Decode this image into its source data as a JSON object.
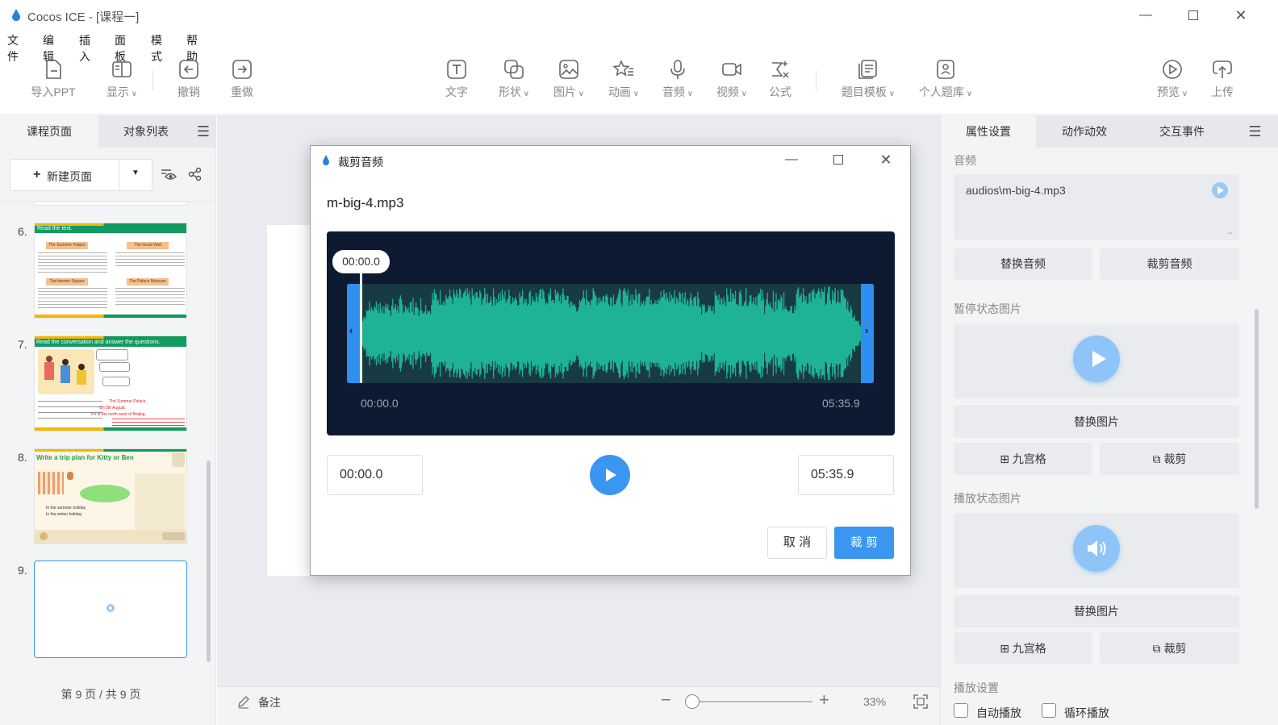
{
  "window": {
    "title": "Cocos ICE - [课程一]"
  },
  "menu": [
    "文件",
    "编辑",
    "插入",
    "面板",
    "模式",
    "帮助"
  ],
  "toolbar": {
    "import_ppt": "导入PPT",
    "display": "显示",
    "undo": "撤销",
    "redo": "重做",
    "text": "文字",
    "shape": "形状",
    "image": "图片",
    "animation": "动画",
    "audio": "音频",
    "video": "视频",
    "formula": "公式",
    "question_template": "题目模板",
    "personal_bank": "个人题库",
    "preview": "预览",
    "upload": "上传"
  },
  "left_panel": {
    "tabs": [
      "课程页面",
      "对象列表"
    ],
    "new_page": "新建页面",
    "pages": [
      {
        "num": "6.",
        "heading": "Read the text.",
        "labels": [
          "The Summer Palace",
          "The Great Wall",
          "Tian'anmen Square",
          "The Palace Museum"
        ]
      },
      {
        "num": "7.",
        "heading": "Read the conversation and answer the questions.",
        "red_answers": [
          "The Summer Palace.",
          "On 5th August.",
          "It's in the north-west of Beijing."
        ]
      },
      {
        "num": "8.",
        "heading": "Write a trip plan for Kitty or Ben",
        "labels": [
          "In the summer holiday",
          "In the winter holiday"
        ]
      },
      {
        "num": "9.",
        "heading": ""
      }
    ],
    "footer": "第 9 页 / 共 9 页"
  },
  "bottom_bar": {
    "notes": "备注",
    "zoom": "33%"
  },
  "right_panel": {
    "tabs": [
      "属性设置",
      "动作动效",
      "交互事件"
    ],
    "audio_label": "音频",
    "audio_path": "audios\\m-big-4.mp3",
    "replace_audio": "替换音频",
    "crop_audio": "裁剪音频",
    "pause_image_label": "暂停状态图片",
    "replace_image": "替换图片",
    "nine_grid": "九宫格",
    "crop": "裁剪",
    "play_image_label": "播放状态图片",
    "play_settings_label": "播放设置",
    "autoplay": "自动播放",
    "loop": "循环播放"
  },
  "dialog": {
    "title": "裁剪音频",
    "filename": "m-big-4.mp3",
    "playhead_time": "00:00.0",
    "axis_start": "00:00.0",
    "axis_end": "05:35.9",
    "start_time": "00:00.0",
    "end_time": "05:35.9",
    "cancel": "取 消",
    "confirm": "裁 剪"
  },
  "colors": {
    "accent": "#3a96f0",
    "wave": "#1db394",
    "wave_bg": "#0e1a32"
  }
}
